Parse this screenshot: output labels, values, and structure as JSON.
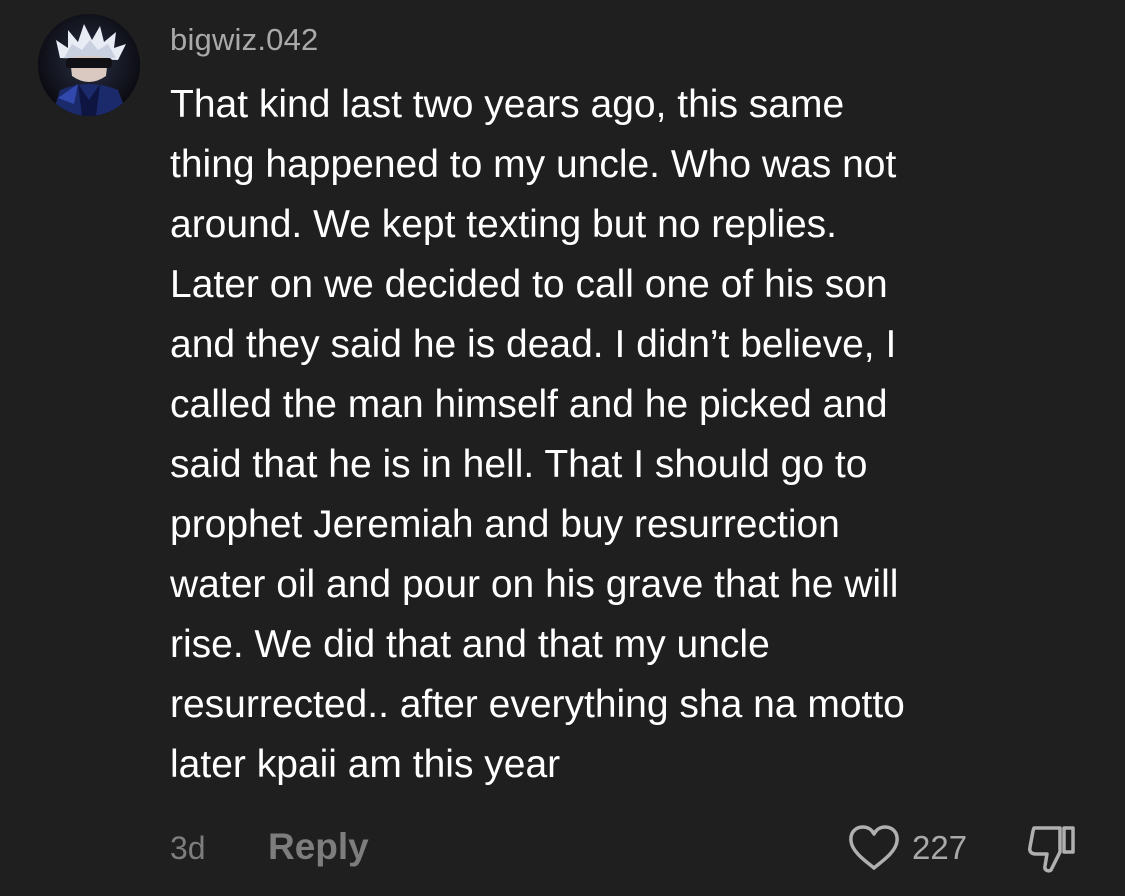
{
  "comment": {
    "username": "bigwiz.042",
    "avatar_icon": "anime-character-avatar",
    "text": "That kind last two years ago, this same\nthing happened to my uncle. Who was not\naround. We kept texting but no replies.\nLater on we decided to call one of his son\nand they said he is dead. I didn’t believe, I\ncalled the man himself and he picked and\nsaid that he is in hell. That I should go to\nprophet Jeremiah and buy resurrection\nwater oil and pour on his grave that he will\nrise. We did that and that my uncle\nresurrected.. after everything sha na motto\nlater kpaii am this year",
    "timestamp": "3d",
    "reply_label": "Reply",
    "like_icon": "heart-outline-icon",
    "like_count": "227",
    "dislike_icon": "thumbs-down-icon"
  },
  "colors": {
    "background": "#1f1f1f",
    "text": "#ffffff",
    "muted": "#7d7d7d",
    "secondary": "#a9a9a9"
  }
}
